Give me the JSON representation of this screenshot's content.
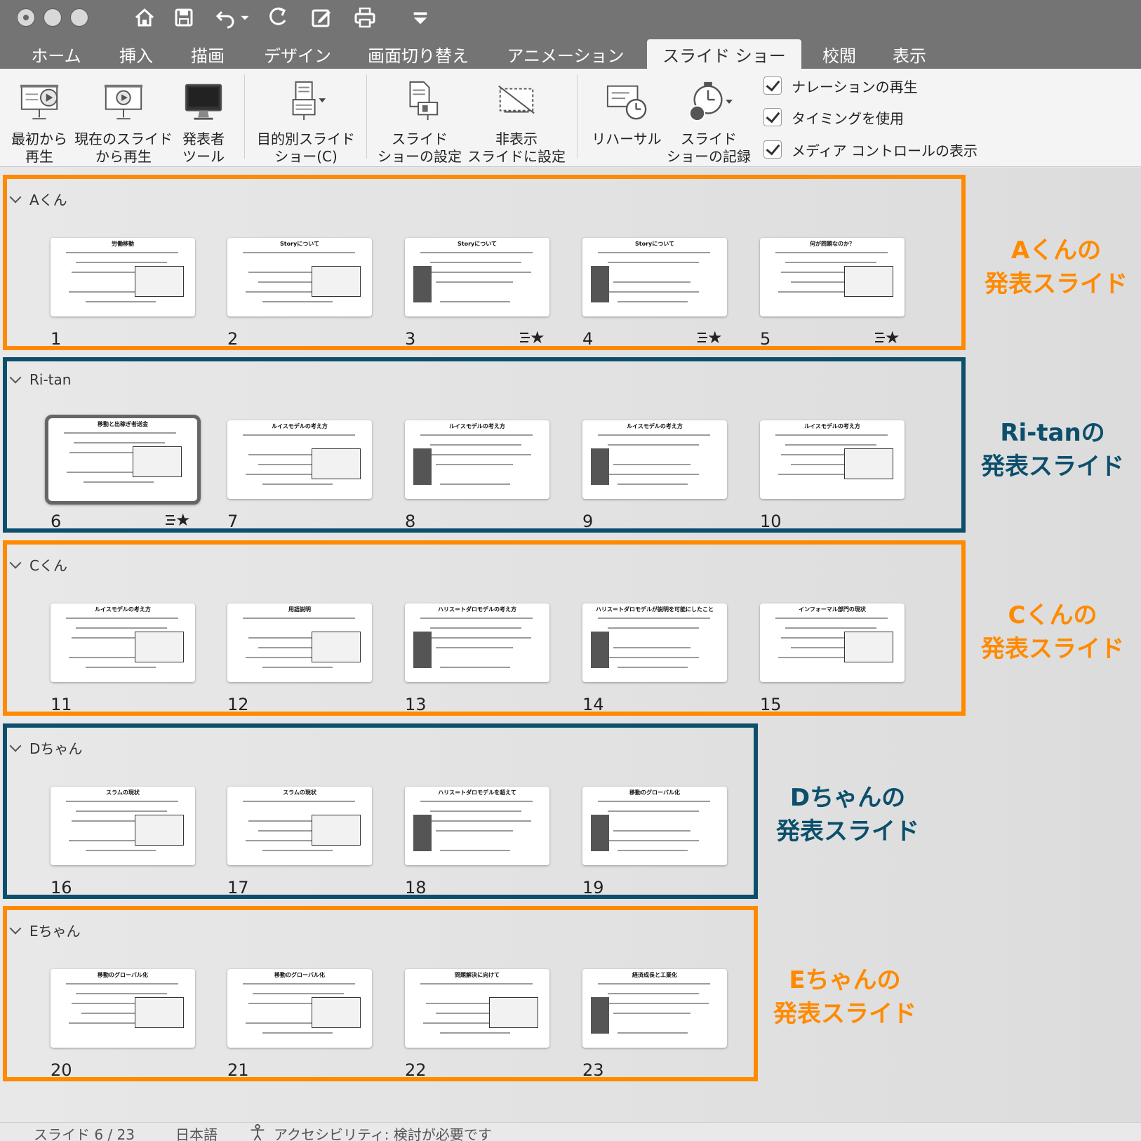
{
  "toolbar": {
    "quick_access": [
      "home-icon",
      "save-icon",
      "undo-icon",
      "redo-icon",
      "edit-icon",
      "print-icon",
      "customize-icon"
    ]
  },
  "tabs": [
    "ホーム",
    "挿入",
    "描画",
    "デザイン",
    "画面切り替え",
    "アニメーション",
    "スライド ショー",
    "校閲",
    "表示"
  ],
  "active_tab": "スライド ショー",
  "ribbon": {
    "from_start": [
      "最初から",
      "再生"
    ],
    "from_current": [
      "現在のスライド",
      "から再生"
    ],
    "presenter": [
      "発表者",
      "ツール"
    ],
    "custom_show": [
      "目的別スライド",
      "ショー(C)"
    ],
    "setup": [
      "スライド",
      "ショーの設定"
    ],
    "hide": [
      "非表示",
      "スライドに設定"
    ],
    "rehearse": "リハーサル",
    "record": [
      "スライド",
      "ショーの記録"
    ],
    "checks": [
      "ナレーションの再生",
      "タイミングを使用",
      "メディア コントロールの表示"
    ]
  },
  "sections": [
    {
      "name": "Aくん",
      "note": [
        "Aくんの",
        "発表スライド"
      ],
      "note_color": "#ff8a00"
    },
    {
      "name": "Ri-tan",
      "note": [
        "Ri-tanの",
        "発表スライド"
      ],
      "note_color": "#0b4f6c"
    },
    {
      "name": "Cくん",
      "note": [
        "Cくんの",
        "発表スライド"
      ],
      "note_color": "#ff8a00"
    },
    {
      "name": "Dちゃん",
      "note": [
        "Dちゃんの",
        "発表スライド"
      ],
      "note_color": "#0b4f6c"
    },
    {
      "name": "Eちゃん",
      "note": [
        "Eちゃんの",
        "発表スライド"
      ],
      "note_color": "#ff8a00"
    }
  ],
  "slides": [
    {
      "n": "1",
      "title": "労働移動",
      "star": false
    },
    {
      "n": "2",
      "title": "Storyについて",
      "star": false
    },
    {
      "n": "3",
      "title": "Storyについて",
      "star": true
    },
    {
      "n": "4",
      "title": "Storyについて",
      "star": true
    },
    {
      "n": "5",
      "title": "何が問題なのか？",
      "star": true
    },
    {
      "n": "6",
      "title": "移動と出稼ぎ者送金",
      "star": true
    },
    {
      "n": "7",
      "title": "ルイスモデルの考え方",
      "star": false
    },
    {
      "n": "8",
      "title": "ルイスモデルの考え方",
      "star": false
    },
    {
      "n": "9",
      "title": "ルイスモデルの考え方",
      "star": false
    },
    {
      "n": "10",
      "title": "ルイスモデルの考え方",
      "star": false
    },
    {
      "n": "11",
      "title": "ルイスモデルの考え方",
      "star": false
    },
    {
      "n": "12",
      "title": "用語説明",
      "star": false
    },
    {
      "n": "13",
      "title": "ハリス＝トダロモデルの考え方",
      "star": false
    },
    {
      "n": "14",
      "title": "ハリス＝トダロモデルが説明を可能にしたこと",
      "star": false
    },
    {
      "n": "15",
      "title": "インフォーマル部門の現状",
      "star": false
    },
    {
      "n": "16",
      "title": "スラムの現状",
      "star": false
    },
    {
      "n": "17",
      "title": "スラムの現状",
      "star": false
    },
    {
      "n": "18",
      "title": "ハリス＝トダロモデルを超えて",
      "star": false
    },
    {
      "n": "19",
      "title": "移動のグローバル化",
      "star": false
    },
    {
      "n": "20",
      "title": "移動のグローバル化",
      "star": false
    },
    {
      "n": "21",
      "title": "移動のグローバル化",
      "star": false
    },
    {
      "n": "22",
      "title": "問題解決に向けて",
      "star": false
    },
    {
      "n": "23",
      "title": "経済成長と工業化",
      "star": false
    }
  ],
  "selected_slide": "6",
  "status": {
    "slide_count": "スライド 6 / 23",
    "language": "日本語",
    "accessibility": "アクセシビリティ: 検討が必要です"
  },
  "colors": {
    "orange": "#ff8a00",
    "navy": "#0b4f6c"
  }
}
